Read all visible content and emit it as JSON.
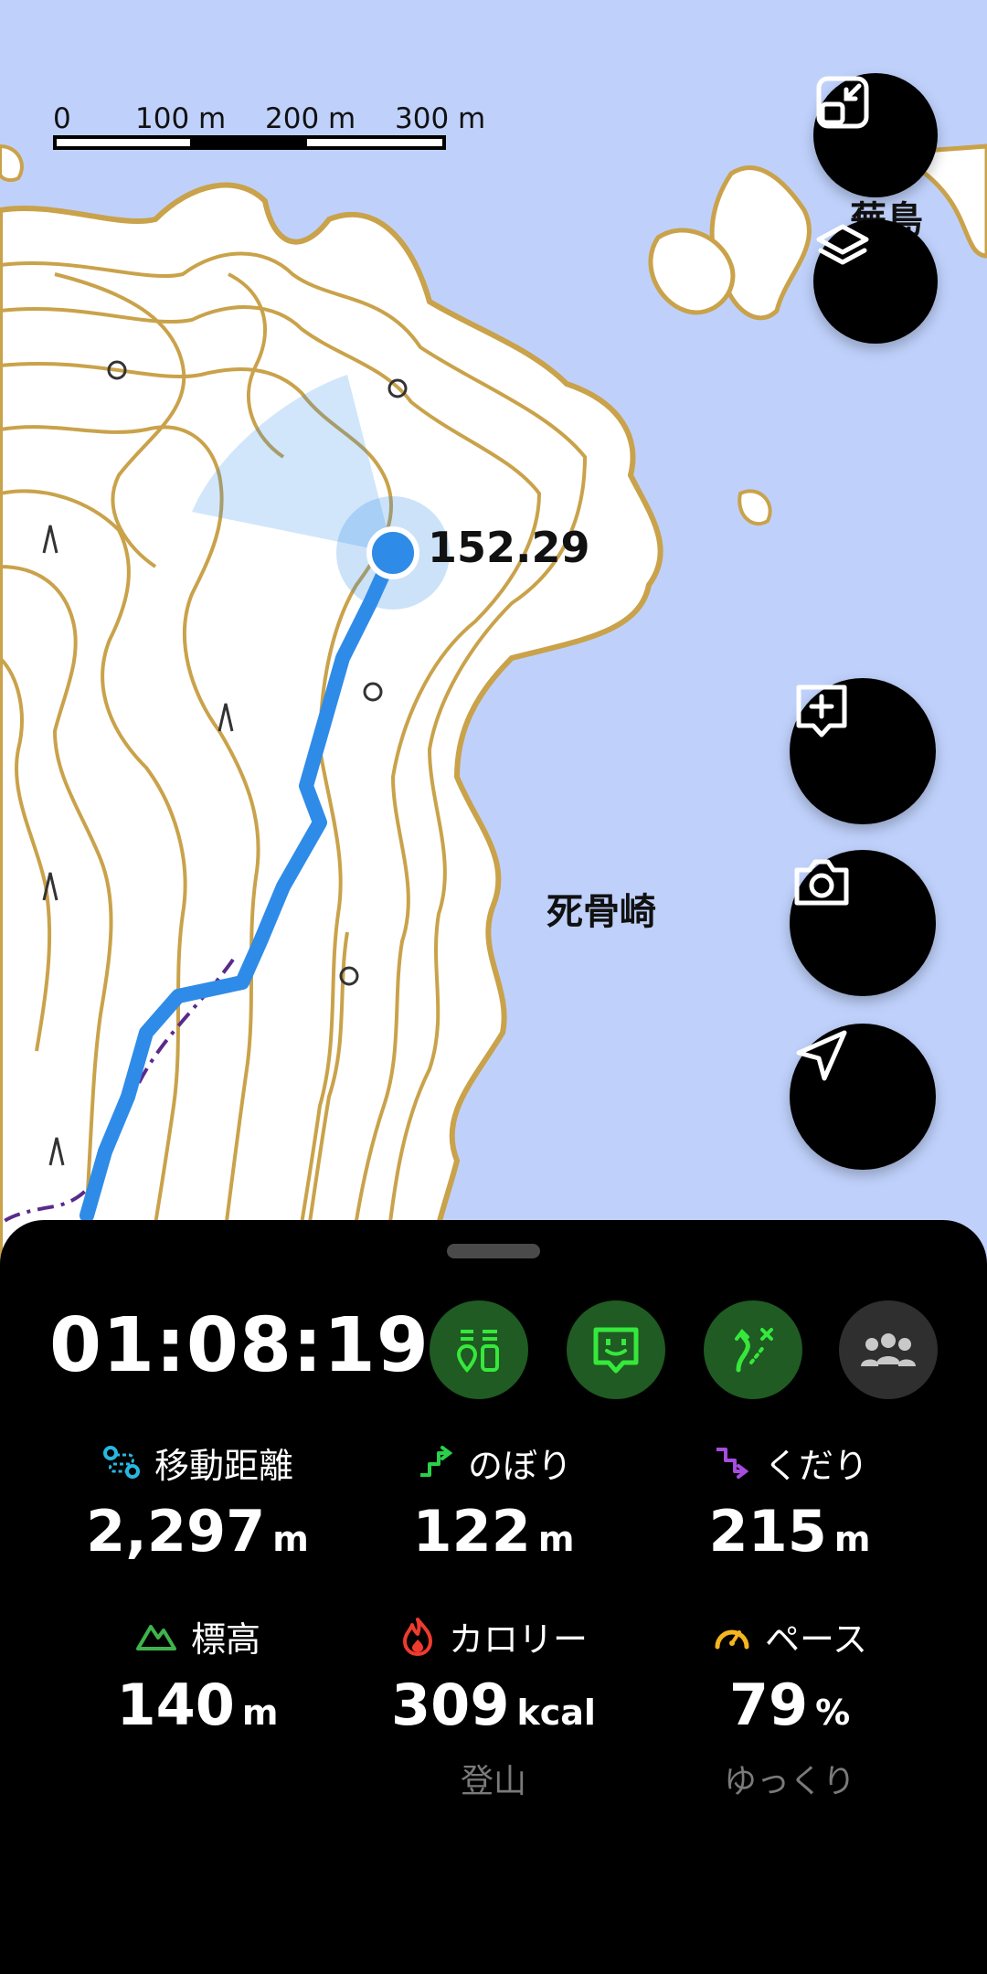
{
  "map": {
    "scale_bar": {
      "ticks": [
        "0",
        "100 m",
        "200 m",
        "300 m"
      ]
    },
    "elevation_label": "152.29",
    "place_labels": {
      "cape": "死骨崎",
      "island": "蕪島"
    },
    "colors": {
      "sea": "#bfd1fb",
      "land": "#ffffff",
      "contour": "#c9a24a",
      "track": "#2f8be8"
    }
  },
  "controls": {
    "icons": [
      "shrink-map-icon",
      "layers-icon",
      "add-memo-icon",
      "camera-icon",
      "navigation-arrow-icon"
    ]
  },
  "panel": {
    "elapsed_time": "01:08:19",
    "actions": [
      {
        "icon": "map-pin-bars-icon",
        "active": true
      },
      {
        "icon": "face-chat-icon",
        "active": true
      },
      {
        "icon": "route-branch-icon",
        "active": true
      },
      {
        "icon": "group-icon",
        "active": false
      }
    ],
    "stats": [
      {
        "label": "移動距離",
        "value": "2,297",
        "unit": "m",
        "icon": "distance-icon",
        "sub": ""
      },
      {
        "label": "のぼり",
        "value": "122",
        "unit": "m",
        "icon": "ascent-icon",
        "sub": ""
      },
      {
        "label": "くだり",
        "value": "215",
        "unit": "m",
        "icon": "descent-icon",
        "sub": ""
      },
      {
        "label": "標高",
        "value": "140",
        "unit": "m",
        "icon": "mountain-icon",
        "sub": ""
      },
      {
        "label": "カロリー",
        "value": "309",
        "unit": "kcal",
        "icon": "flame-icon",
        "sub": "登山"
      },
      {
        "label": "ペース",
        "value": "79",
        "unit": "%",
        "icon": "speedometer-icon",
        "sub": "ゆっくり"
      }
    ]
  }
}
